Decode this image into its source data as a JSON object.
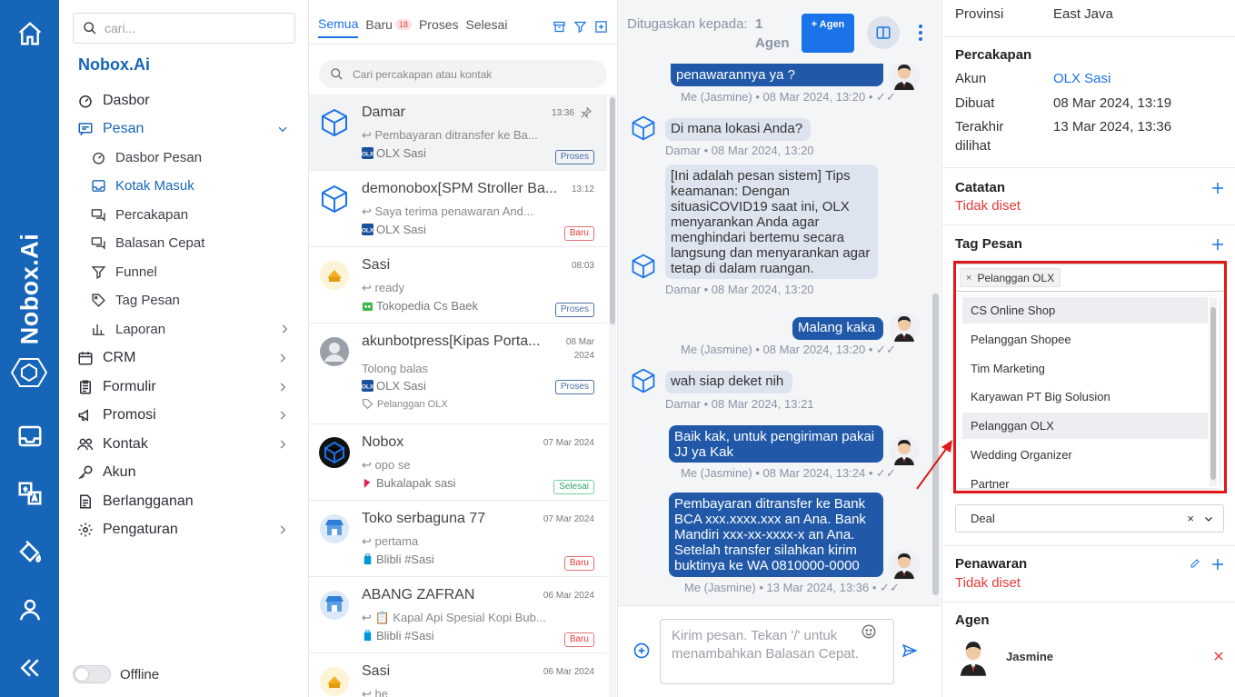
{
  "rail": {
    "brand": "Nobox.Ai"
  },
  "nav": {
    "search_placeholder": "cari...",
    "brand": "Nobox.Ai",
    "items": [
      {
        "label": "Dasbor"
      },
      {
        "label": "Pesan"
      },
      {
        "label": "Dasbor Pesan"
      },
      {
        "label": "Kotak Masuk"
      },
      {
        "label": "Percakapan"
      },
      {
        "label": "Balasan Cepat"
      },
      {
        "label": "Funnel"
      },
      {
        "label": "Tag Pesan"
      },
      {
        "label": "Laporan"
      },
      {
        "label": "CRM"
      },
      {
        "label": "Formulir"
      },
      {
        "label": "Promosi"
      },
      {
        "label": "Kontak"
      },
      {
        "label": "Akun"
      },
      {
        "label": "Berlangganan"
      },
      {
        "label": "Pengaturan"
      }
    ],
    "offline_label": "Offline"
  },
  "conversations": {
    "tabs": [
      {
        "label": "Semua"
      },
      {
        "label": "Baru",
        "badge": "18"
      },
      {
        "label": "Proses"
      },
      {
        "label": "Selesai"
      }
    ],
    "search_placeholder": "Cari percakapan atau kontak",
    "items": [
      {
        "name": "Damar",
        "time": "13:36",
        "preview": "Pembayaran ditransfer ke Ba...",
        "source": "OLX Sasi",
        "status": "Proses"
      },
      {
        "name": "demonobox[SPM Stroller Ba...",
        "time": "13:12",
        "preview": "Saya terima penawaran And...",
        "source": "OLX Sasi",
        "status": "Baru"
      },
      {
        "name": "Sasi",
        "time": "08:03",
        "preview": "ready",
        "source": "Tokopedia Cs Baek",
        "status": "Proses"
      },
      {
        "name": "akunbotpress[Kipas Porta...",
        "time": "08 Mar 2024",
        "preview": "Tolong balas",
        "source": "OLX Sasi",
        "status": "Proses",
        "tag": "Pelanggan OLX"
      },
      {
        "name": "Nobox",
        "time": "07 Mar 2024",
        "preview": "opo se",
        "source": "Bukalapak sasi",
        "status": "Selesai"
      },
      {
        "name": "Toko serbaguna 77",
        "time": "07 Mar 2024",
        "preview": "pertama",
        "source": "Blibli #Sasi",
        "status": "Baru"
      },
      {
        "name": "ABANG ZAFRAN",
        "time": "06 Mar 2024",
        "preview": "📋 Kapal Api Spesial Kopi Bub...",
        "source": "Blibli #Sasi",
        "status": "Baru"
      },
      {
        "name": "Sasi",
        "time": "06 Mar 2024",
        "preview": "he"
      }
    ]
  },
  "chat": {
    "assign_label": "Ditugaskan kepada:",
    "assign_value": "1 Agen",
    "add_agent": "+ Agen",
    "messages": [
      {
        "text": "penawarannya ya ?",
        "meta": "Me (Jasmine) • 08 Mar 2024, 13:20 •"
      },
      {
        "text": "Di mana lokasi Anda?",
        "meta": "Damar • 08 Mar 2024, 13:20"
      },
      {
        "text": "[Ini adalah pesan sistem] Tips keamanan: Dengan situasiCOVID19 saat ini, OLX menyarankan Anda agar menghindari bertemu secara langsung dan menyarankan agar tetap di dalam ruangan.",
        "meta": "Damar • 08 Mar 2024, 13:20"
      },
      {
        "text": "Malang kaka",
        "meta": "Me (Jasmine) • 08 Mar 2024, 13:20 •"
      },
      {
        "text": "wah siap deket nih",
        "meta": "Damar • 08 Mar 2024, 13:21"
      },
      {
        "text": "Baik kak, untuk pengiriman pakai JJ ya Kak",
        "meta": "Me (Jasmine) • 08 Mar 2024, 13:24 •"
      },
      {
        "text": "Pembayaran ditransfer ke Bank BCA xxx.xxxx.xxx an Ana. Bank Mandiri xxx-xx-xxxx-x an Ana. Setelah transfer silahkan kirim buktinya ke WA 0810000-0000",
        "meta": "Me (Jasmine) • 13 Mar 2024, 13:36 •"
      }
    ],
    "composer_placeholder": "Kirim pesan. Tekan '/' untuk menambahkan Balasan Cepat."
  },
  "details": {
    "provinsi_label": "Provinsi",
    "provinsi_value": "East Java",
    "percakapan_title": "Percakapan",
    "akun_label": "Akun",
    "akun_value": "OLX Sasi",
    "dibuat_label": "Dibuat",
    "dibuat_value": "08 Mar 2024, 13:19",
    "terakhir_label": "Terakhir dilihat",
    "terakhir_value": "13 Mar 2024, 13:36",
    "catatan_title": "Catatan",
    "catatan_value": "Tidak diset",
    "tag_title": "Tag Pesan",
    "selected_tag": "Pelanggan OLX",
    "tag_options": [
      "CS Online Shop",
      "Pelanggan Shopee",
      "Tim Marketing",
      "Karyawan PT Big Solusion",
      "Pelanggan OLX",
      "Wedding Organizer",
      "Partner"
    ],
    "deal_value": "Deal",
    "penawaran_title": "Penawaran",
    "penawaran_value": "Tidak diset",
    "agen_title": "Agen",
    "agent_name": "Jasmine"
  }
}
